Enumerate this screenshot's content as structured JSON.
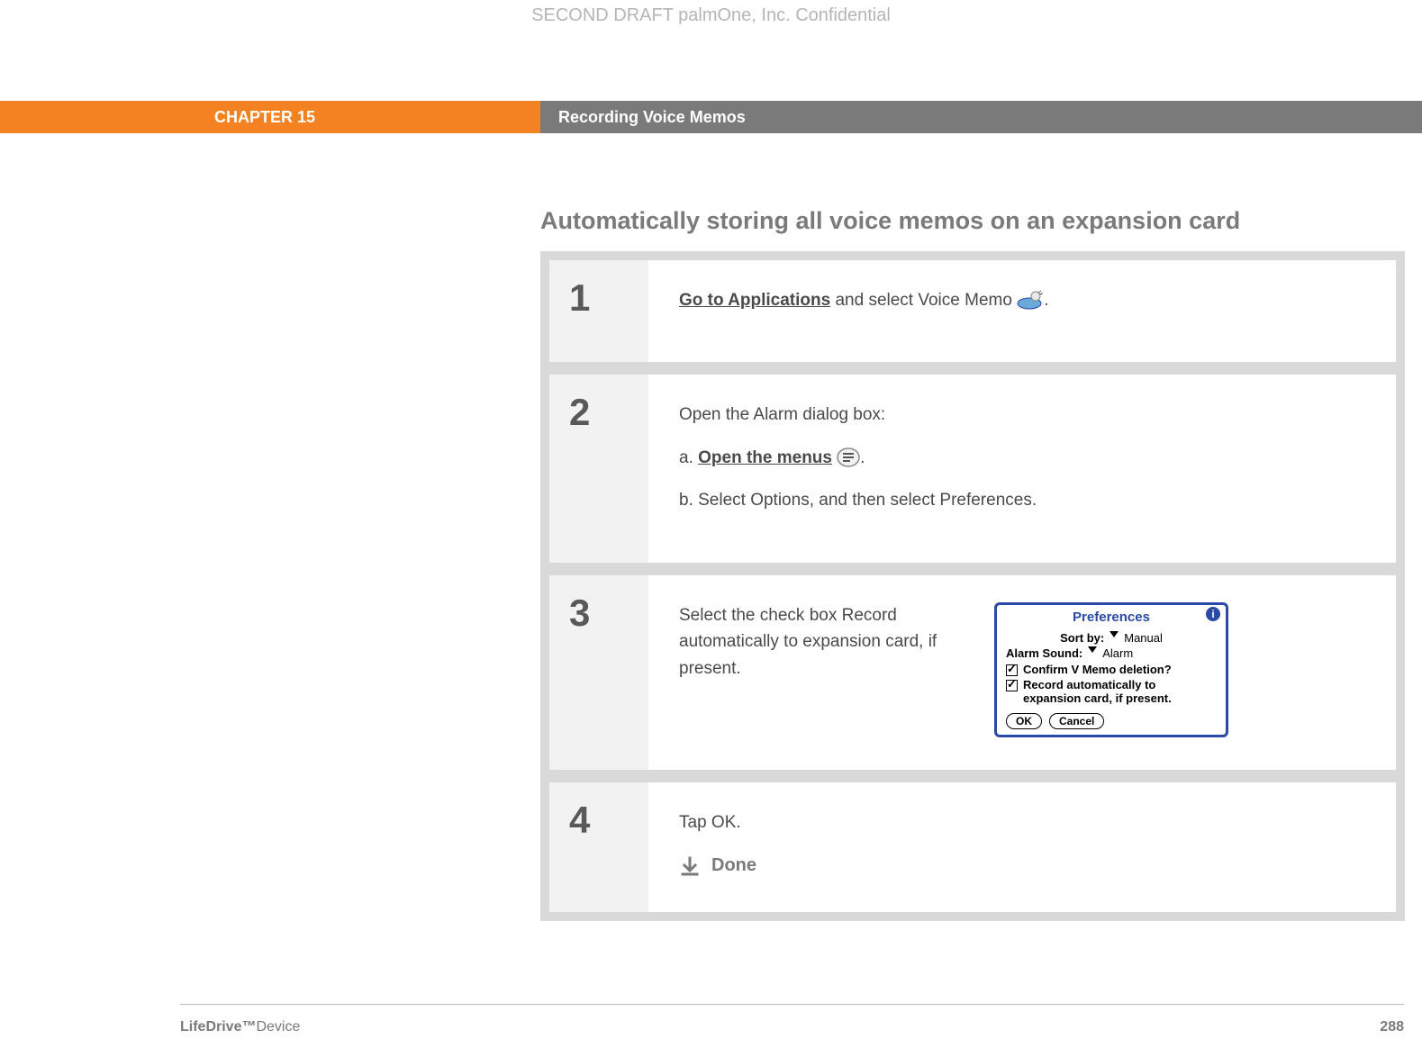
{
  "header": {
    "draft_banner": "SECOND DRAFT palmOne, Inc.  Confidential",
    "chapter_label": "CHAPTER 15",
    "chapter_title": "Recording Voice Memos"
  },
  "section": {
    "heading": "Automatically storing all voice memos on an expansion card"
  },
  "steps": [
    {
      "num": "1",
      "go_to_apps_link": "Go to Applications",
      "rest": " and select Voice Memo ",
      "period": "."
    },
    {
      "num": "2",
      "intro": "Open the Alarm dialog box:",
      "a_prefix": "a.  ",
      "a_link": "Open the menus",
      "a_suffix": " ",
      "a_period": ".",
      "b": "b.  Select Options, and then select Preferences."
    },
    {
      "num": "3",
      "text": "Select the check box Record automatically to expansion card, if present.",
      "prefs": {
        "title": "Preferences",
        "sortby_label": "Sort by:",
        "sortby_value": "Manual",
        "alarm_label": "Alarm Sound:",
        "alarm_value": "Alarm",
        "check1": "Confirm V Memo deletion?",
        "check2": "Record automatically to expansion card, if present.",
        "ok": "OK",
        "cancel": "Cancel"
      }
    },
    {
      "num": "4",
      "text": "Tap OK.",
      "done": "Done"
    }
  ],
  "footer": {
    "device_bold": "LifeDrive™",
    "device_rest": "Device",
    "page": "288"
  }
}
